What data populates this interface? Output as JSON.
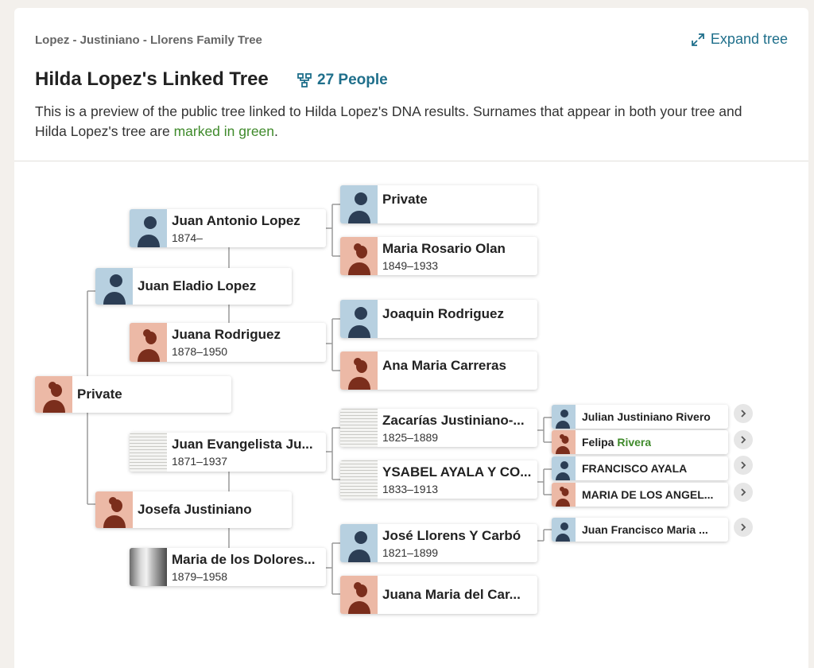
{
  "header": {
    "breadcrumb": "Lopez - Justiniano - Llorens Family Tree",
    "expand_label": "Expand tree",
    "title": "Hilda Lopez's Linked Tree",
    "people_count": "27 People",
    "description_before": "This is a preview of the public tree linked to Hilda Lopez's DNA results. Surnames that appear in both your tree and Hilda Lopez's tree are ",
    "description_link": "marked in green",
    "description_after": "."
  },
  "colors": {
    "accent": "#1f6f8b",
    "match_green": "#3f8a2b",
    "male_avatar": "#b7d0e0",
    "female_avatar": "#ecb9a6"
  },
  "tree": {
    "root": {
      "name": "Private",
      "dates": "",
      "gender": "female"
    },
    "father": {
      "name": "Juan Eladio Lopez",
      "dates": "",
      "gender": "male"
    },
    "mother": {
      "name": "Josefa Justiniano",
      "dates": "",
      "gender": "female"
    },
    "pat_grandfather": {
      "name": "Juan Antonio Lopez",
      "dates": "1874–",
      "gender": "male"
    },
    "pat_grandmother": {
      "name": "Juana Rodriguez",
      "dates": "1878–1950",
      "gender": "female"
    },
    "mat_grandfather": {
      "name": "Juan Evangelista Ju...",
      "dates": "1871–1937",
      "avatar": "document"
    },
    "mat_grandmother": {
      "name": "Maria de los Dolores...",
      "dates": "1879–1958",
      "avatar": "photo"
    },
    "ggp1": {
      "name": "Private",
      "dates": "",
      "gender": "male"
    },
    "ggp2": {
      "name": "Maria Rosario Olan",
      "dates": "1849–1933",
      "gender": "female"
    },
    "ggp3": {
      "name": "Joaquin Rodriguez",
      "dates": "",
      "gender": "male"
    },
    "ggp4": {
      "name": "Ana Maria Carreras",
      "dates": "",
      "gender": "female"
    },
    "ggp5": {
      "name": "Zacarías Justiniano-...",
      "dates": "1825–1889",
      "avatar": "document"
    },
    "ggp6": {
      "name": "YSABEL AYALA Y CO...",
      "dates": "1833–1913",
      "avatar": "document"
    },
    "ggp7": {
      "name": "José Llorens Y Carbó",
      "dates": "1821–1899",
      "gender": "male"
    },
    "ggp8": {
      "name": "Juana Maria del Car...",
      "dates": "",
      "gender": "female"
    },
    "gggp1": {
      "name": "Julian Justiniano Rivero",
      "gender": "male"
    },
    "gggp2": {
      "name_plain": "Felipa ",
      "name_green": "Rivera",
      "gender": "female"
    },
    "gggp3": {
      "name": "FRANCISCO AYALA",
      "gender": "male"
    },
    "gggp4": {
      "name": "MARIA DE LOS ANGEL...",
      "gender": "female"
    },
    "gggp5": {
      "name": "Juan Francisco Maria ...",
      "gender": "male"
    }
  }
}
